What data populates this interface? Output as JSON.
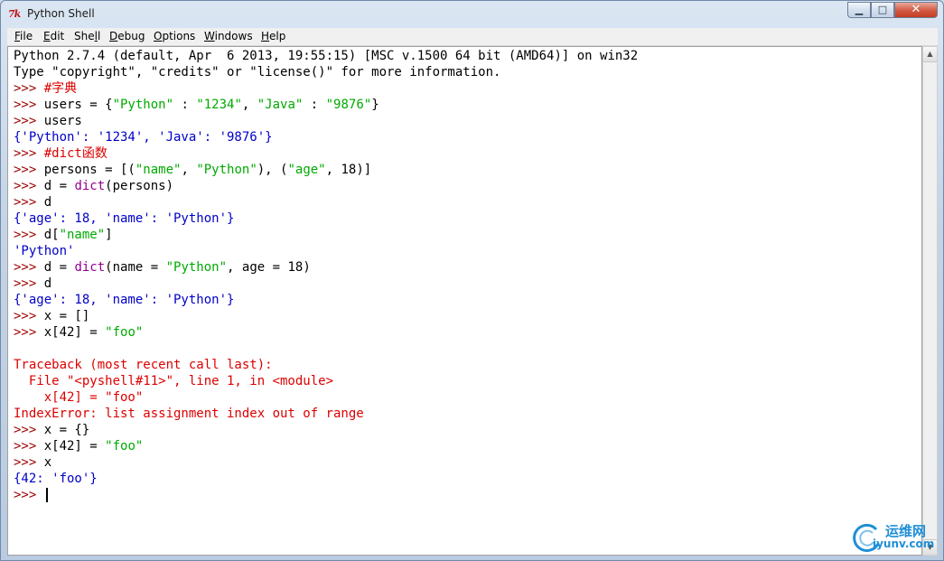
{
  "window": {
    "title": "Python Shell",
    "icon": "tk-feather-icon",
    "controls": {
      "minimize": "▁",
      "maximize": "□",
      "close": "✕"
    }
  },
  "menubar": {
    "items": [
      {
        "label": "File",
        "mnemonic": "F",
        "rest": "ile"
      },
      {
        "label": "Edit",
        "mnemonic": "E",
        "rest": "dit"
      },
      {
        "label": "Shell",
        "mnemonic": "",
        "pre": "She",
        "u": "l",
        "post": "l"
      },
      {
        "label": "Debug",
        "mnemonic": "D",
        "rest": "ebug"
      },
      {
        "label": "Options",
        "mnemonic": "O",
        "rest": "ptions"
      },
      {
        "label": "Windows",
        "mnemonic": "W",
        "rest": "indows"
      },
      {
        "label": "Help",
        "mnemonic": "H",
        "rest": "elp"
      }
    ]
  },
  "shell": {
    "prompt": ">>> ",
    "lines": [
      [
        {
          "t": "Python 2.7.4 (default, Apr  6 2013, 19:55:15) [MSC v.1500 64 bit (AMD64)] on win32",
          "c": ""
        }
      ],
      [
        {
          "t": "Type \"copyright\", \"credits\" or \"license()\" for more information.",
          "c": ""
        }
      ],
      [
        {
          "t": ">>> ",
          "c": "c-prompt"
        },
        {
          "t": "#字典",
          "c": "c-comment"
        }
      ],
      [
        {
          "t": ">>> ",
          "c": "c-prompt"
        },
        {
          "t": "users = {",
          "c": ""
        },
        {
          "t": "\"Python\"",
          "c": "c-string"
        },
        {
          "t": " : ",
          "c": ""
        },
        {
          "t": "\"1234\"",
          "c": "c-string"
        },
        {
          "t": ", ",
          "c": ""
        },
        {
          "t": "\"Java\"",
          "c": "c-string"
        },
        {
          "t": " : ",
          "c": ""
        },
        {
          "t": "\"9876\"",
          "c": "c-string"
        },
        {
          "t": "}",
          "c": ""
        }
      ],
      [
        {
          "t": ">>> ",
          "c": "c-prompt"
        },
        {
          "t": "users",
          "c": ""
        }
      ],
      [
        {
          "t": "{'Python': '1234', 'Java': '9876'}",
          "c": "c-output"
        }
      ],
      [
        {
          "t": ">>> ",
          "c": "c-prompt"
        },
        {
          "t": "#dict函数",
          "c": "c-comment"
        }
      ],
      [
        {
          "t": ">>> ",
          "c": "c-prompt"
        },
        {
          "t": "persons = [(",
          "c": ""
        },
        {
          "t": "\"name\"",
          "c": "c-string"
        },
        {
          "t": ", ",
          "c": ""
        },
        {
          "t": "\"Python\"",
          "c": "c-string"
        },
        {
          "t": "), (",
          "c": ""
        },
        {
          "t": "\"age\"",
          "c": "c-string"
        },
        {
          "t": ", 18)]",
          "c": ""
        }
      ],
      [
        {
          "t": ">>> ",
          "c": "c-prompt"
        },
        {
          "t": "d = ",
          "c": ""
        },
        {
          "t": "dict",
          "c": "c-builtin"
        },
        {
          "t": "(persons)",
          "c": ""
        }
      ],
      [
        {
          "t": ">>> ",
          "c": "c-prompt"
        },
        {
          "t": "d",
          "c": ""
        }
      ],
      [
        {
          "t": "{'age': 18, 'name': 'Python'}",
          "c": "c-output"
        }
      ],
      [
        {
          "t": ">>> ",
          "c": "c-prompt"
        },
        {
          "t": "d[",
          "c": ""
        },
        {
          "t": "\"name\"",
          "c": "c-string"
        },
        {
          "t": "]",
          "c": ""
        }
      ],
      [
        {
          "t": "'Python'",
          "c": "c-output"
        }
      ],
      [
        {
          "t": ">>> ",
          "c": "c-prompt"
        },
        {
          "t": "d = ",
          "c": ""
        },
        {
          "t": "dict",
          "c": "c-builtin"
        },
        {
          "t": "(name = ",
          "c": ""
        },
        {
          "t": "\"Python\"",
          "c": "c-string"
        },
        {
          "t": ", age = 18)",
          "c": ""
        }
      ],
      [
        {
          "t": ">>> ",
          "c": "c-prompt"
        },
        {
          "t": "d",
          "c": ""
        }
      ],
      [
        {
          "t": "{'age': 18, 'name': 'Python'}",
          "c": "c-output"
        }
      ],
      [
        {
          "t": ">>> ",
          "c": "c-prompt"
        },
        {
          "t": "x = []",
          "c": ""
        }
      ],
      [
        {
          "t": ">>> ",
          "c": "c-prompt"
        },
        {
          "t": "x[42] = ",
          "c": ""
        },
        {
          "t": "\"foo\"",
          "c": "c-string"
        }
      ],
      [],
      [
        {
          "t": "Traceback (most recent call last):",
          "c": "c-error"
        }
      ],
      [
        {
          "t": "  File \"<pyshell#11>\", line 1, in <module>",
          "c": "c-error"
        }
      ],
      [
        {
          "t": "    x[42] = \"foo\"",
          "c": "c-error"
        }
      ],
      [
        {
          "t": "IndexError: list assignment index out of range",
          "c": "c-error"
        }
      ],
      [
        {
          "t": ">>> ",
          "c": "c-prompt"
        },
        {
          "t": "x = {}",
          "c": ""
        }
      ],
      [
        {
          "t": ">>> ",
          "c": "c-prompt"
        },
        {
          "t": "x[42] = ",
          "c": ""
        },
        {
          "t": "\"foo\"",
          "c": "c-string"
        }
      ],
      [
        {
          "t": ">>> ",
          "c": "c-prompt"
        },
        {
          "t": "x",
          "c": ""
        }
      ],
      [
        {
          "t": "{42: 'foo'}",
          "c": "c-output"
        }
      ],
      [
        {
          "t": ">>> ",
          "c": "c-prompt"
        }
      ]
    ]
  },
  "watermark": {
    "cn": "运维网",
    "en": "iyunv.com"
  },
  "colors": {
    "prompt": "#9b0000",
    "comment": "#dd0000",
    "string": "#00aa00",
    "builtin": "#900090",
    "output": "#0000c8",
    "error": "#dd0000"
  }
}
